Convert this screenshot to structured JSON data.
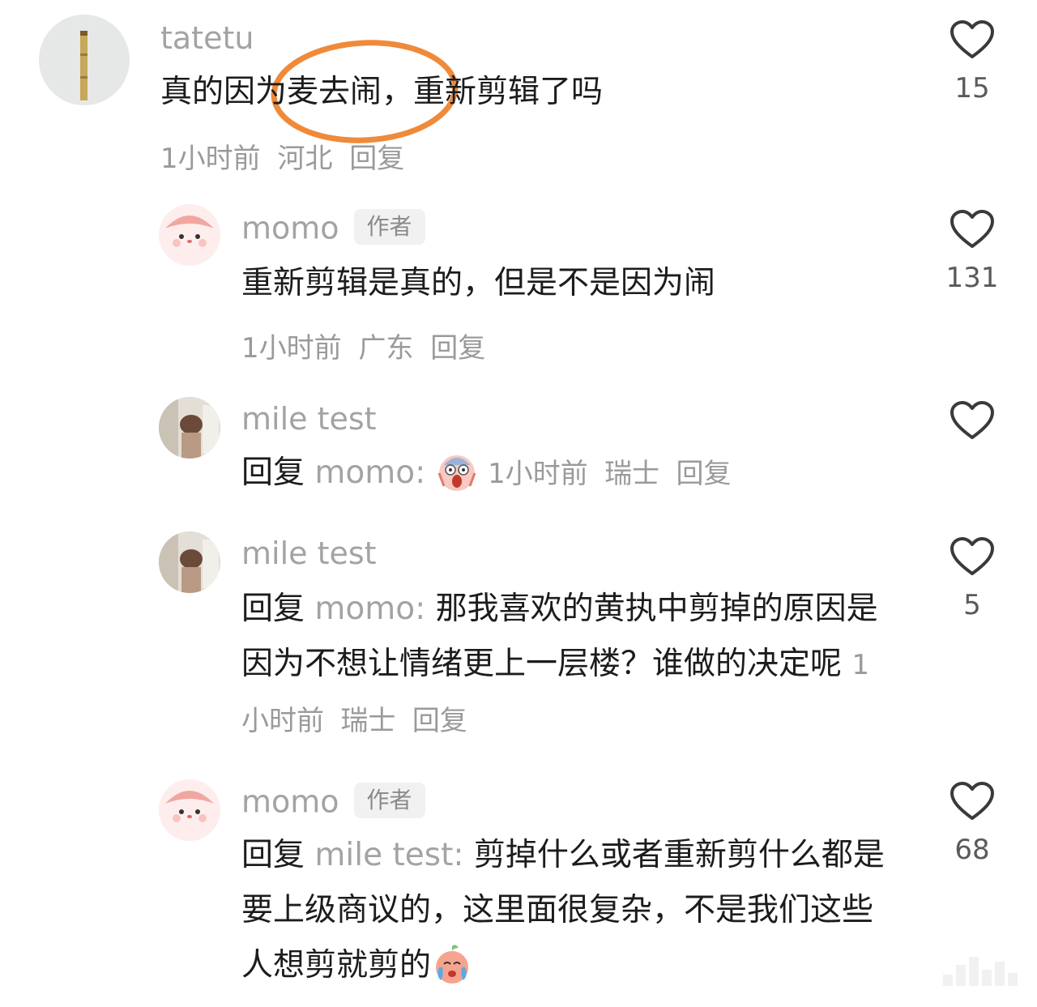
{
  "comments": [
    {
      "user": "tatetu",
      "badge": "",
      "text": "真的因为麦去闹，重新剪辑了吗",
      "time": "1小时前",
      "location": "河北",
      "reply_label": "回复",
      "likes": "15"
    },
    {
      "user": "momo",
      "badge": "作者",
      "text": "重新剪辑是真的，但是不是因为闹",
      "time": "1小时前",
      "location": "广东",
      "reply_label": "回复",
      "likes": "131"
    },
    {
      "user": "mile test",
      "badge": "",
      "reply_prefix": "回复",
      "reply_to": "momo:",
      "text": "",
      "time": "1小时前",
      "location": "瑞士",
      "reply_label": "回复",
      "likes": ""
    },
    {
      "user": "mile test",
      "badge": "",
      "reply_prefix": "回复",
      "reply_to": "momo:",
      "text": "那我喜欢的黄执中剪掉的原因是因为不想让情绪更上一层楼？谁做的决定呢",
      "time": "1小时前",
      "location": "瑞士",
      "reply_label": "回复",
      "likes": "5"
    },
    {
      "user": "momo",
      "badge": "作者",
      "reply_prefix": "回复",
      "reply_to": "mile test:",
      "text": "剪掉什么或者重新剪什么都是要上级商议的，这里面很复杂，不是我们这些人想剪就剪的",
      "time": "",
      "location": "",
      "reply_label": "",
      "likes": "68"
    }
  ],
  "icons": {
    "like": "heart-outline-icon",
    "scream_emoji": "screaming-face-emoji",
    "crying_emoji": "crying-peach-emoji"
  },
  "colors": {
    "highlight_circle": "#ef8a3a",
    "username": "#a3a3a3",
    "text": "#1c1c1c"
  }
}
